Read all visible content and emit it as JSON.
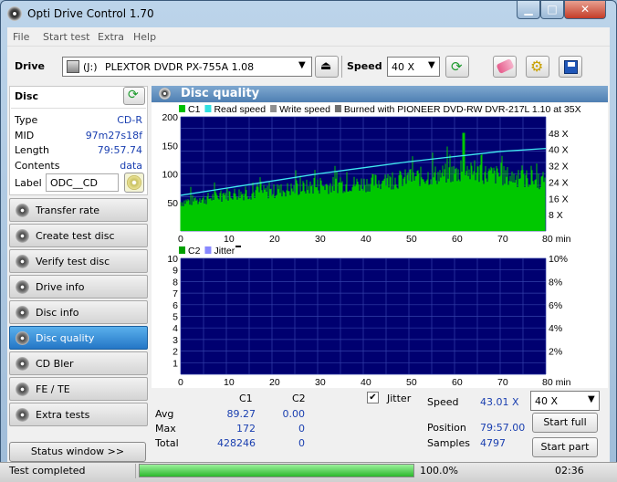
{
  "window": {
    "title": "Opti Drive Control 1.70",
    "min": "▭",
    "max": "□",
    "close": "✕"
  },
  "menu": [
    "File",
    "Start test",
    "Extra",
    "Help"
  ],
  "toolbar": {
    "drive_label": "Drive",
    "drive_letter": "(J:)",
    "drive_name": "PLEXTOR DVDR   PX-755A 1.08",
    "speed_label": "Speed",
    "speed_value": "40 X"
  },
  "disc": {
    "header": "Disc",
    "rows": [
      {
        "k": "Type",
        "v": "CD-R"
      },
      {
        "k": "MID",
        "v": "97m27s18f"
      },
      {
        "k": "Length",
        "v": "79:57.74"
      },
      {
        "k": "Contents",
        "v": "data"
      }
    ],
    "label_key": "Label",
    "label_value": "ODC__CD"
  },
  "nav": [
    {
      "label": "Transfer rate",
      "active": false
    },
    {
      "label": "Create test disc",
      "active": false
    },
    {
      "label": "Verify test disc",
      "active": false
    },
    {
      "label": "Drive info",
      "active": false
    },
    {
      "label": "Disc info",
      "active": false
    },
    {
      "label": "Disc quality",
      "active": true
    },
    {
      "label": "CD Bler",
      "active": false
    },
    {
      "label": "FE / TE",
      "active": false
    },
    {
      "label": "Extra tests",
      "active": false
    }
  ],
  "status_window_btn": "Status window >>",
  "section_title": "Disc quality",
  "chart_data": [
    {
      "type": "bar",
      "name": "C1 chart",
      "legend": [
        "C1",
        "Read speed",
        "Write speed",
        "Burned with PIONEER DVD-RW  DVR-217L 1.10 at 35X"
      ],
      "legend_colors": [
        "#00c000",
        "#30e0e0",
        "#909090",
        "#707070"
      ],
      "x_ticks": [
        "0",
        "10",
        "20",
        "30",
        "40",
        "50",
        "60",
        "70",
        "80 min"
      ],
      "y_left_ticks": [
        "200",
        "150",
        "100",
        "50"
      ],
      "y_right_ticks": [
        "48 X",
        "40 X",
        "32 X",
        "24 X",
        "16 X",
        "8 X"
      ],
      "xlim": [
        0,
        80
      ],
      "ylim": [
        0,
        200
      ],
      "c1_envelope": {
        "x": [
          0,
          5,
          10,
          15,
          20,
          25,
          30,
          35,
          40,
          45,
          50,
          55,
          60,
          65,
          70,
          75,
          80
        ],
        "y": [
          55,
          60,
          70,
          72,
          75,
          80,
          85,
          88,
          90,
          95,
          100,
          105,
          110,
          110,
          105,
          100,
          95
        ]
      },
      "c1_peak": {
        "x": 62,
        "y": 172
      },
      "read_speed": {
        "x": [
          0,
          10,
          20,
          30,
          40,
          50,
          60,
          70,
          80
        ],
        "y": [
          17.5,
          21,
          24.5,
          28,
          31,
          34,
          36.5,
          39,
          40.5
        ]
      }
    },
    {
      "type": "bar",
      "name": "C2 chart",
      "legend": [
        "C2",
        "Jitter"
      ],
      "legend_colors": [
        "#00a000",
        "#8888ff"
      ],
      "x_ticks": [
        "0",
        "10",
        "20",
        "30",
        "40",
        "50",
        "60",
        "70",
        "80 min"
      ],
      "y_left_ticks": [
        "10",
        "9",
        "8",
        "7",
        "6",
        "5",
        "4",
        "3",
        "2",
        "1"
      ],
      "y_right_ticks": [
        "10%",
        "8%",
        "6%",
        "4%",
        "2%"
      ],
      "xlim": [
        0,
        80
      ],
      "ylim": [
        0,
        10
      ],
      "c2_values": []
    }
  ],
  "stats": {
    "head_c1": "C1",
    "head_c2": "C2",
    "rows": [
      {
        "k": "Avg",
        "c1": "89.27",
        "c2": "0.00"
      },
      {
        "k": "Max",
        "c1": "172",
        "c2": "0"
      },
      {
        "k": "Total",
        "c1": "428246",
        "c2": "0"
      }
    ],
    "jitter_label": "Jitter",
    "jitter_checked": true,
    "speed_label": "Speed",
    "speed_value": "43.01 X",
    "position_label": "Position",
    "position_value": "79:57.00",
    "samples_label": "Samples",
    "samples_value": "4797",
    "speed_select": "40 X",
    "start_full": "Start full",
    "start_part": "Start part"
  },
  "statusbar": {
    "text": "Test completed",
    "progress": 1.0,
    "progress_text": "100.0%",
    "time": "02:36"
  }
}
